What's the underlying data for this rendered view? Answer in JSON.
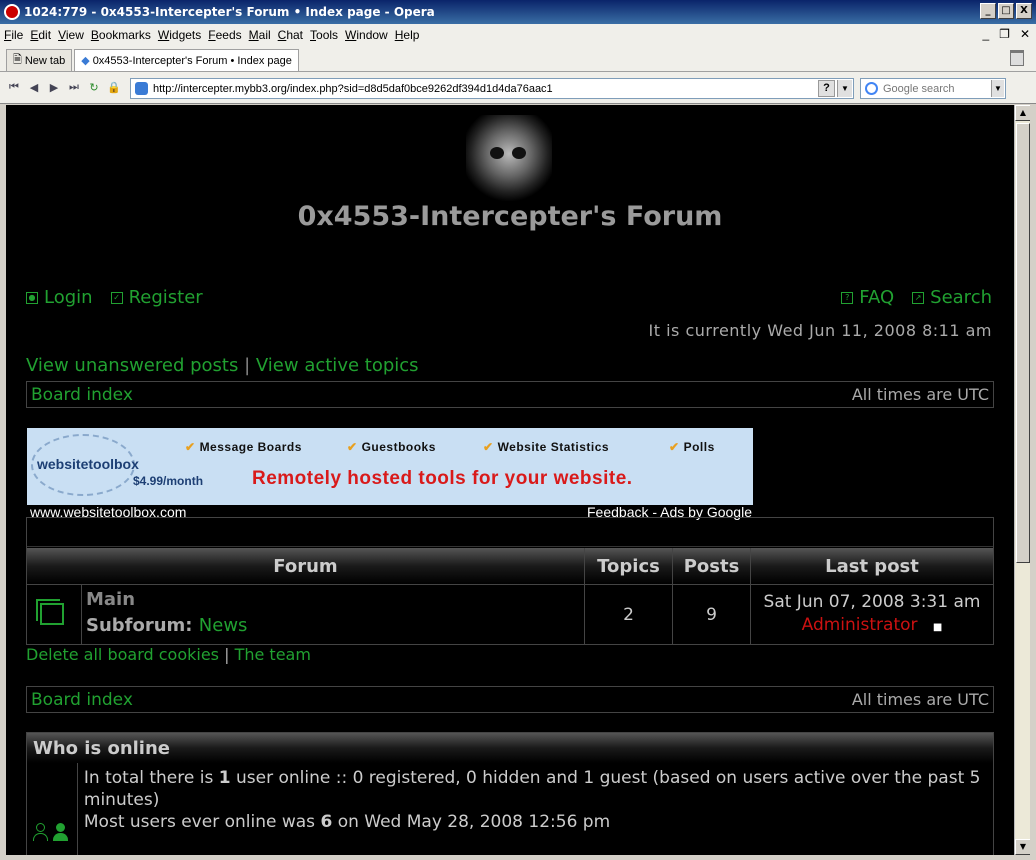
{
  "window": {
    "title": "1024:779 - 0x4553-Intercepter's Forum • Index page - Opera",
    "buttons": [
      "_",
      "□",
      "X"
    ]
  },
  "menu": [
    "File",
    "Edit",
    "View",
    "Bookmarks",
    "Widgets",
    "Feeds",
    "Mail",
    "Chat",
    "Tools",
    "Window",
    "Help"
  ],
  "tabs": [
    {
      "label": "New tab"
    },
    {
      "label": "0x4553-Intercepter's Forum • Index page"
    }
  ],
  "address": {
    "url": "http://intercepter.mybb3.org/index.php?sid=d8d5daf0bce9262df394d1d4da76aac1",
    "help": "?",
    "search_placeholder": "Google search"
  },
  "page": {
    "site_title": "0x4553-Intercepter's Forum",
    "login": "Login",
    "register": "Register",
    "faq": "FAQ",
    "search": "Search",
    "current_time": "It is currently Wed Jun 11, 2008 8:11 am",
    "view_unanswered": "View unanswered posts",
    "separator": "|",
    "view_active": "View active topics",
    "board_index": "Board index",
    "timezone": "All times are UTC",
    "ad": {
      "brand": "websitetoolbox",
      "price": "$4.99/month",
      "features": [
        "Message Boards",
        "Guestbooks",
        "Website Statistics",
        "Polls"
      ],
      "tagline": "Remotely hosted tools for your website.",
      "url": "www.websitetoolbox.com",
      "feedback": "Feedback - Ads by Google"
    },
    "forum_table": {
      "headers": [
        "Forum",
        "Topics",
        "Posts",
        "Last post"
      ],
      "row": {
        "name": "Main",
        "subforum_label": "Subforum:",
        "subforum_link": "News",
        "topics": "2",
        "posts": "9",
        "last_post_date": "Sat Jun 07, 2008 3:31 am",
        "last_post_author": "Administrator"
      }
    },
    "delete_cookies": "Delete all board cookies",
    "the_team": "The team",
    "who_online": {
      "title": "Who is online",
      "line1_a": "In total there is ",
      "line1_b": "1",
      "line1_c": " user online :: 0 registered, 0 hidden and 1 guest (based on users active over the past 5 minutes)",
      "line2_a": "Most users ever online was ",
      "line2_b": "6",
      "line2_c": " on Wed May 28, 2008 12:56 pm"
    }
  },
  "colors": {
    "link_green": "#21a131",
    "author_red": "#cc1111",
    "page_bg": "#000000"
  }
}
